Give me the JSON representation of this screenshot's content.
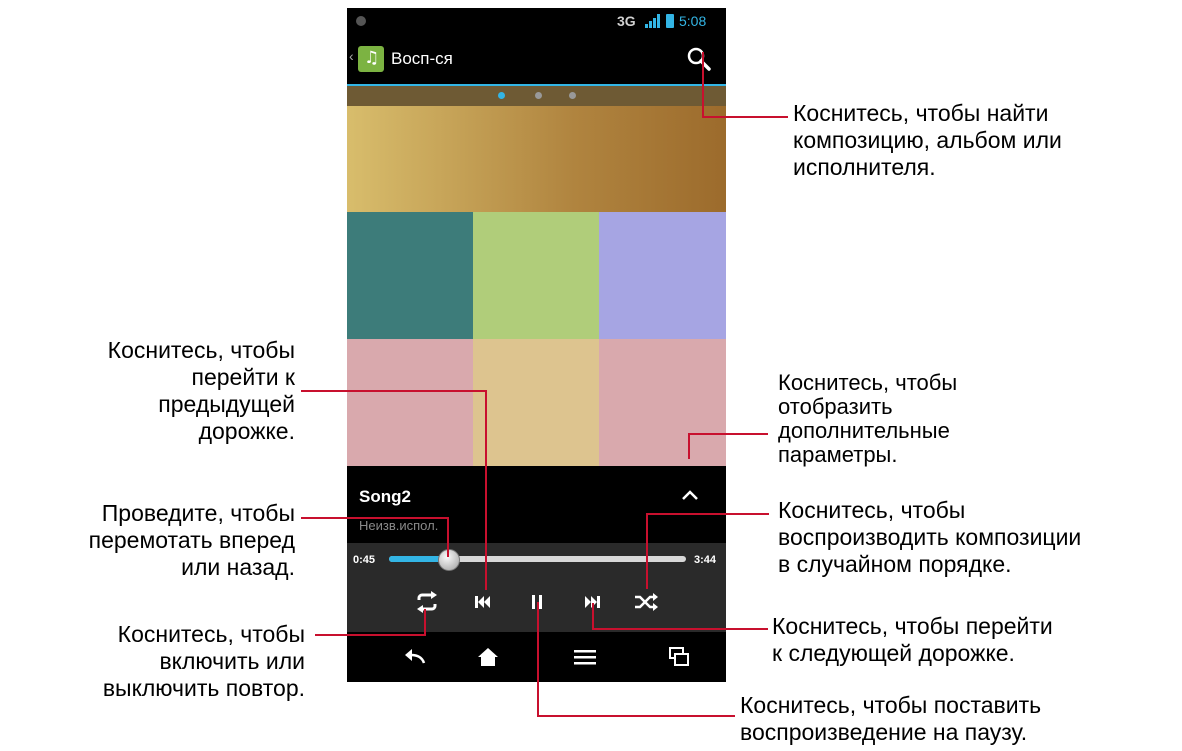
{
  "status_bar": {
    "network": "3G",
    "time": "5:08"
  },
  "action_bar": {
    "title": "Восп-ся",
    "icons": [
      "back-chevron-icon",
      "music-app-icon",
      "search-icon"
    ]
  },
  "pager": {
    "pages": 3,
    "active": 0
  },
  "album_colors": {
    "top_gradient": [
      "#d8bd6c",
      "#9c6b2c"
    ],
    "tiles": [
      "#3d7c7a",
      "#b0cd7a",
      "#a6a5e3",
      "#d9a9ad",
      "#ddc48f",
      "#d9a9ad"
    ]
  },
  "now_playing": {
    "song": "Song2",
    "artist": "Неизв.испол."
  },
  "progress": {
    "current": "0:45",
    "total": "3:44",
    "fraction": 0.2
  },
  "controls": [
    "repeat-icon",
    "previous-icon",
    "pause-icon",
    "next-icon",
    "shuffle-icon"
  ],
  "nav_bar": [
    "back-icon",
    "home-icon",
    "menu-icon",
    "recent-apps-icon"
  ],
  "accent_color": "#33b5e5",
  "callout_color": "#c8102e",
  "callouts": {
    "search": "Коснитесь, чтобы найти\nкомпозицию, альбом или\nисполнителя.",
    "prev": "Коснитесь, чтобы\nперейти к\nпредыдущей\nдорожке.",
    "seek": "Проведите, чтобы\nперемотать вперед\nили назад.",
    "repeat": "Коснитесь, чтобы\nвключить или\nвыключить повтор.",
    "more": "Коснитесь, чтобы\nотобразить\nдополнительные\nпараметры.",
    "shuffle": "Коснитесь, чтобы\nвоспроизводить композиции\nв случайном порядке.",
    "next": "Коснитесь, чтобы перейти\nк следующей дорожке.",
    "pause": "Коснитесь, чтобы поставить\nвоспроизведение на паузу."
  }
}
